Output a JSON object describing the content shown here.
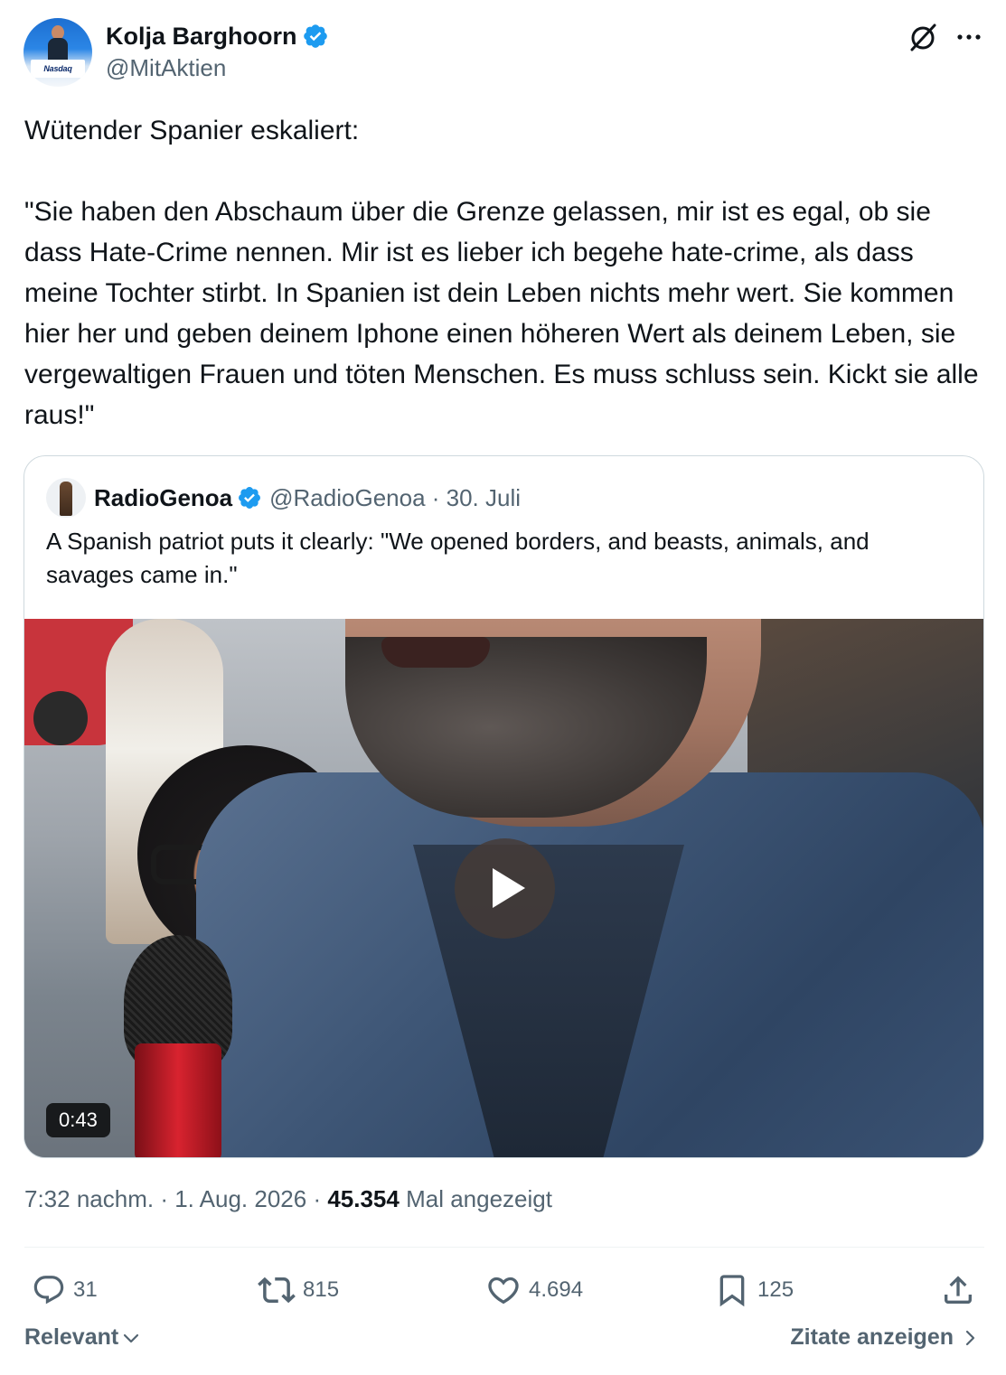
{
  "author": {
    "name": "Kolja Barghoorn",
    "handle": "@MitAktien",
    "avatar_logo_text": "Nasdaq"
  },
  "tweet": {
    "text": "Wütender Spanier eskaliert:\n\n\"Sie haben den Abschaum über die Grenze gelassen, mir ist es egal, ob sie dass Hate-Crime nennen. Mir ist es lieber ich begehe hate-crime, als dass meine Tochter stirbt. In Spanien ist dein Leben nichts mehr wert. Sie kommen hier her und geben deinem Iphone einen höheren Wert als deinem Leben, sie vergewaltigen Frauen und töten Menschen. Es muss schluss sein. Kickt sie alle raus!\""
  },
  "quote": {
    "name": "RadioGenoa",
    "handle_date": "@RadioGenoa · 30. Juli",
    "text": "A Spanish patriot puts it clearly: \"We opened borders, and beasts, animals, and savages came in.\"",
    "video_duration": "0:43"
  },
  "meta": {
    "time_date": "7:32 nachm. · 1. Aug. 2026 · ",
    "views_count": "45.354",
    "views_label": " Mal angezeigt"
  },
  "actions": {
    "replies": "31",
    "reposts": "815",
    "likes": "4.694",
    "bookmarks": "125"
  },
  "footer": {
    "sort_label": "Relevant",
    "quotes_link": "Zitate anzeigen"
  },
  "icons": [
    "verified-badge-icon",
    "grok-icon",
    "more-icon",
    "play-icon",
    "reply-icon",
    "repost-icon",
    "like-icon",
    "bookmark-icon",
    "share-icon",
    "chevron-down-icon",
    "chevron-right-icon"
  ],
  "colors": {
    "verified": "#1d9bf0",
    "secondary_text": "#536471",
    "primary_text": "#0f1419",
    "border": "#cfd9de"
  }
}
